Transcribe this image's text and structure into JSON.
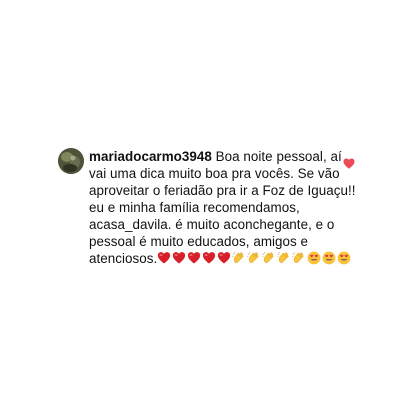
{
  "comment": {
    "username": "mariadocarmo3948",
    "text": " Boa noite pessoal, aí vai uma dica muito boa pra vocês. Se vão aproveitar o feriadão pra ir a Foz de Iguaçu!! eu e minha família recomendamos, acasa_davila. é muito aconchegante, e o pessoal é muito educados, amigos e atenciosos.",
    "emojis": [
      "red-heart-icon",
      "red-heart-icon",
      "red-heart-icon",
      "red-heart-icon",
      "red-heart-icon",
      "clapping-hands-icon",
      "clapping-hands-icon",
      "clapping-hands-icon",
      "clapping-hands-icon",
      "clapping-hands-icon",
      "heart-eyes-face-icon",
      "heart-eyes-face-icon",
      "heart-eyes-face-icon"
    ]
  },
  "colors": {
    "like_heart": "#ed4956",
    "emoji_heart": "#d8202b",
    "clap_yellow": "#f7c53b",
    "face_yellow": "#f9c23c",
    "face_heart": "#e0323c"
  }
}
